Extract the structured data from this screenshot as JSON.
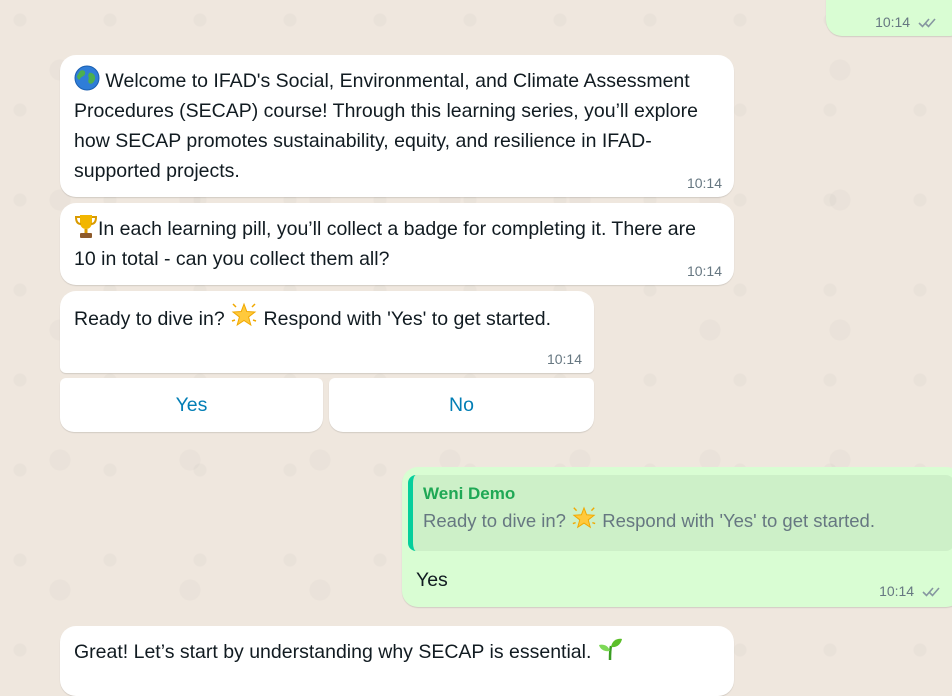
{
  "chat": {
    "top_partial": {
      "time": "10:14"
    },
    "msg1": {
      "text": "Welcome to IFAD's Social, Environmental, and Climate Assessment Procedures (SECAP) course! Through this learning series, you’ll explore how SECAP promotes sustainability, equity, and resilience in IFAD-supported projects.",
      "time": "10:14",
      "emoji_icon": "globe-icon"
    },
    "msg2": {
      "text": "In each learning pill, you’ll collect a badge for completing it. There are 10 in total - can you collect them all?",
      "time": "10:14",
      "emoji_icon": "trophy-icon"
    },
    "msg3": {
      "text_before": "Ready to dive in?",
      "text_after": "Respond with 'Yes' to get started.",
      "time": "10:14",
      "emoji_icon": "star-icon"
    },
    "buttons": {
      "yes": "Yes",
      "no": "No"
    },
    "reply": {
      "quoted_author": "Weni Demo",
      "quoted_before": "Ready to dive in?",
      "quoted_after": "Respond with 'Yes' to get started.",
      "text": "Yes",
      "time": "10:14"
    },
    "msg4": {
      "text": "Great! Let’s start by understanding why SECAP is essential.",
      "emoji_icon": "seedling-icon"
    }
  },
  "colors": {
    "wallpaper": "#efe7de",
    "incoming": "#ffffff",
    "outgoing": "#d9fdd3",
    "button_text": "#027eb5",
    "quote_bar": "#06cf9c",
    "quote_author": "#1fa855",
    "read_ticks": "#8696a0"
  }
}
